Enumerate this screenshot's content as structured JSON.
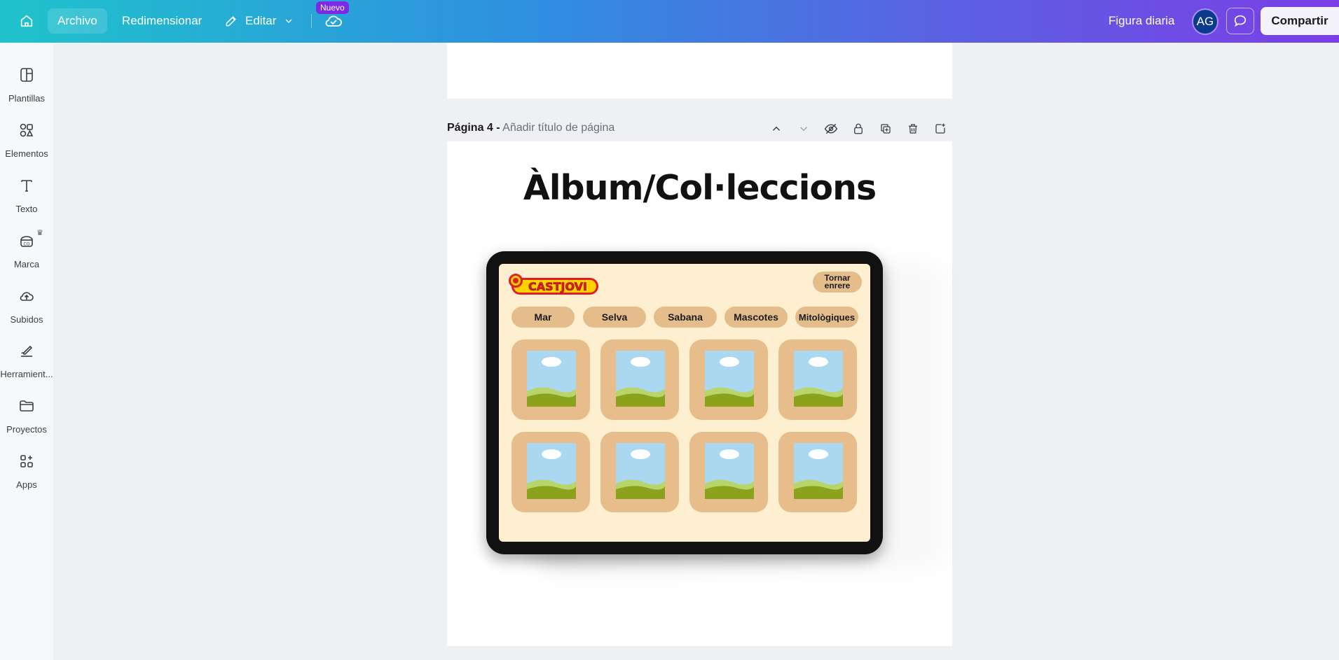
{
  "topbar": {
    "menu_file": "Archivo",
    "menu_resize": "Redimensionar",
    "menu_edit": "Editar",
    "new_badge": "Nuevo",
    "doc_title": "Figura diaria",
    "avatar_initials": "AG",
    "share_label": "Compartir"
  },
  "sidebar": {
    "items": [
      {
        "label": "Plantillas",
        "icon": "templates-icon"
      },
      {
        "label": "Elementos",
        "icon": "elements-icon"
      },
      {
        "label": "Texto",
        "icon": "text-icon"
      },
      {
        "label": "Marca",
        "icon": "brand-icon"
      },
      {
        "label": "Subidos",
        "icon": "uploads-icon"
      },
      {
        "label": "Herramient...",
        "icon": "tools-icon"
      },
      {
        "label": "Proyectos",
        "icon": "projects-icon"
      },
      {
        "label": "Apps",
        "icon": "apps-icon"
      }
    ]
  },
  "page": {
    "number_label": "Página 4 -",
    "title_placeholder": "Añadir título de página",
    "heading": "Àlbum/Col·leccions"
  },
  "mockup": {
    "logo_text": "CASTJOVI",
    "back_button": "Tornar enrere",
    "categories": [
      "Mar",
      "Selva",
      "Sabana",
      "Mascotes",
      "Mitològiques"
    ]
  },
  "colors": {
    "accent_purple": "#7d2ae8",
    "screen_bg": "#fdefcf",
    "card_bg": "#e8bd8c",
    "logo_red": "#e31b23",
    "logo_yellow": "#ffd200"
  }
}
